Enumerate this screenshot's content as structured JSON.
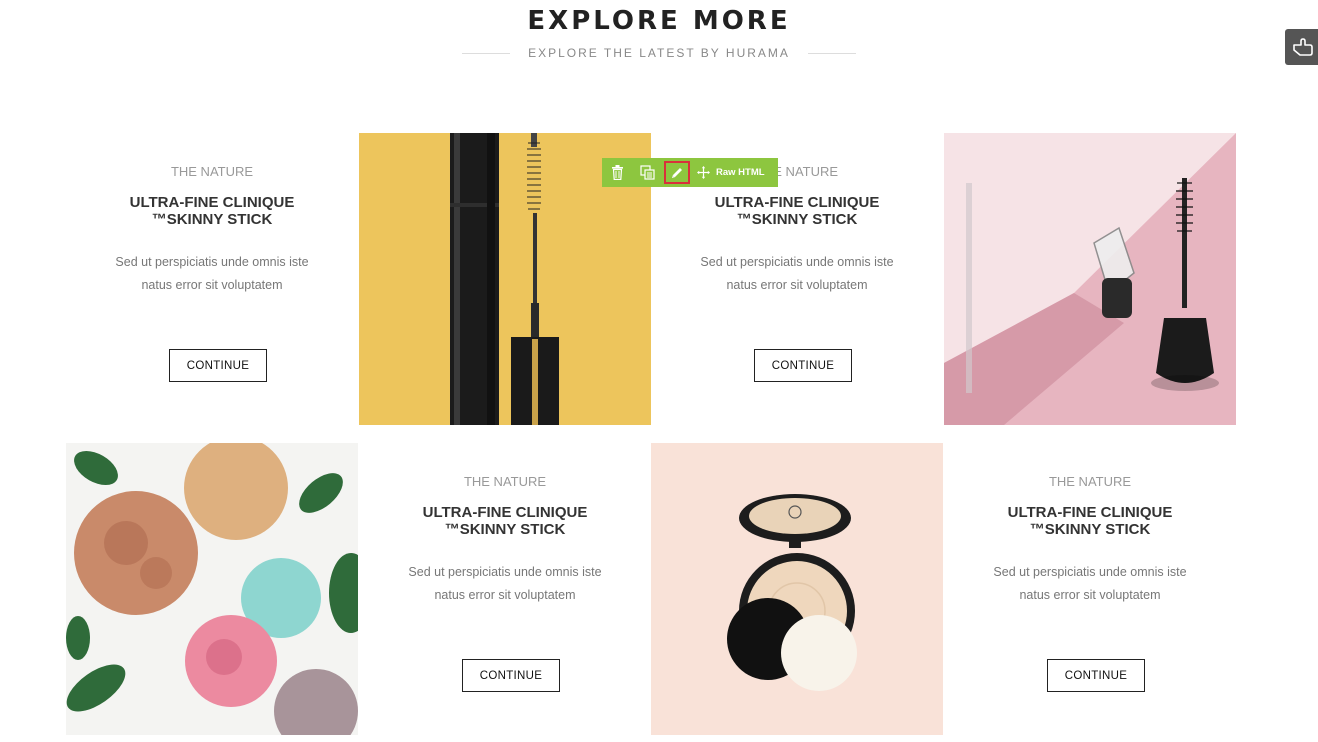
{
  "header": {
    "title": "EXPLORE MORE",
    "subtitle": "EXPLORE THE LATEST BY HURAMA"
  },
  "cards": [
    {
      "brand": "THE NATURE",
      "name_line1": "ULTRA-FINE CLINIQUE",
      "name_line2": "™SKINNY STICK",
      "desc_line1": "Sed ut perspiciatis unde omnis iste",
      "desc_line2": "natus error sit voluptatem",
      "button": "CONTINUE"
    },
    {
      "brand": "THE NATURE",
      "name_line1": "ULTRA-FINE CLINIQUE",
      "name_line2": "™SKINNY STICK",
      "desc_line1": "Sed ut perspiciatis unde omnis iste",
      "desc_line2": "natus error sit voluptatem",
      "button": "CONTINUE"
    },
    {
      "brand": "THE NATURE",
      "name_line1": "ULTRA-FINE CLINIQUE",
      "name_line2": "™SKINNY STICK",
      "desc_line1": "Sed ut perspiciatis unde omnis iste",
      "desc_line2": "natus error sit voluptatem",
      "button": "CONTINUE"
    },
    {
      "brand": "THE NATURE",
      "name_line1": "ULTRA-FINE CLINIQUE",
      "name_line2": "™SKINNY STICK",
      "desc_line1": "Sed ut perspiciatis unde omnis iste",
      "desc_line2": "natus error sit voluptatem",
      "button": "CONTINUE"
    }
  ],
  "images": [
    {
      "icon": "mascara-product-image",
      "bg": "#edc55c"
    },
    {
      "icon": "mascara-pink-product-image",
      "bg": "#f3d8dd"
    },
    {
      "icon": "makeup-powders-image",
      "bg": "#f4f4f2"
    },
    {
      "icon": "compact-powder-image",
      "bg": "#f9e0d6"
    }
  ],
  "editor_toolbar": {
    "label": "Raw HTML",
    "accent": "#8dc63f",
    "highlight": "#d9303b"
  }
}
